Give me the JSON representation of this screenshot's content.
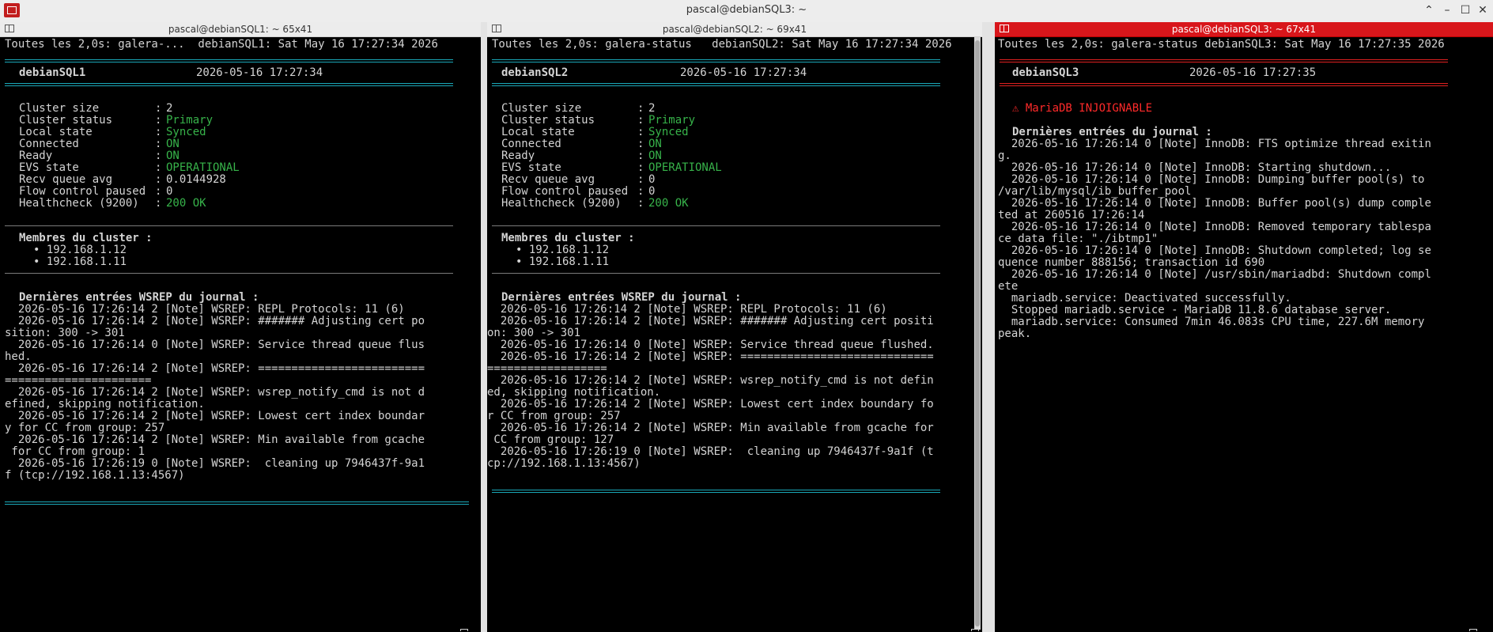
{
  "window": {
    "title": "pascal@debianSQL3: ~",
    "ctl_up": "⌃",
    "ctl_min": "–",
    "ctl_max": "☐",
    "ctl_close": "✕"
  },
  "pane1": {
    "title": "pascal@debianSQL1: ~ 65x41",
    "header": "Toutes les 2,0s: galera-...  debianSQL1: Sat May 16 17:27:34 2026",
    "host": "debianSQL1",
    "time": "2026-05-16 17:27:34",
    "stats": [
      {
        "label": "Cluster size",
        "value": "2",
        "green": false
      },
      {
        "label": "Cluster status",
        "value": "Primary",
        "green": true
      },
      {
        "label": "Local state",
        "value": "Synced",
        "green": true
      },
      {
        "label": "Connected",
        "value": "ON",
        "green": true
      },
      {
        "label": "Ready",
        "value": "ON",
        "green": true
      },
      {
        "label": "EVS state",
        "value": "OPERATIONAL",
        "green": true
      },
      {
        "label": "Recv queue avg",
        "value": "0.0144928",
        "green": false
      },
      {
        "label": "Flow control paused",
        "value": "0",
        "green": false
      },
      {
        "label": "Healthcheck (9200)",
        "value": "200 OK",
        "green": true
      }
    ],
    "members_title": "Membres du cluster :",
    "members": [
      "• 192.168.1.12",
      "• 192.168.1.11"
    ],
    "log_title": "Dernières entrées WSREP du journal :",
    "log": [
      "  2026-05-16 17:26:14 2 [Note] WSREP: REPL Protocols: 11 (6)",
      "  2026-05-16 17:26:14 2 [Note] WSREP: ####### Adjusting cert po",
      "sition: 300 -> 301",
      "  2026-05-16 17:26:14 0 [Note] WSREP: Service thread queue flus",
      "hed.",
      "  2026-05-16 17:26:14 2 [Note] WSREP: =========================",
      "======================",
      "  2026-05-16 17:26:14 2 [Note] WSREP: wsrep_notify_cmd is not d",
      "efined, skipping notification.",
      "  2026-05-16 17:26:14 2 [Note] WSREP: Lowest cert index boundar",
      "y for CC from group: 257",
      "  2026-05-16 17:26:14 2 [Note] WSREP: Min available from gcache",
      " for CC from group: 1",
      "  2026-05-16 17:26:19 0 [Note] WSREP:  cleaning up 7946437f-9a1",
      "f (tcp://192.168.1.13:4567)"
    ]
  },
  "pane2": {
    "title": "pascal@debianSQL2: ~ 69x41",
    "header": "Toutes les 2,0s: galera-status   debianSQL2: Sat May 16 17:27:34 2026",
    "host": "debianSQL2",
    "time": "2026-05-16 17:27:34",
    "stats": [
      {
        "label": "Cluster size",
        "value": "2",
        "green": false
      },
      {
        "label": "Cluster status",
        "value": "Primary",
        "green": true
      },
      {
        "label": "Local state",
        "value": "Synced",
        "green": true
      },
      {
        "label": "Connected",
        "value": "ON",
        "green": true
      },
      {
        "label": "Ready",
        "value": "ON",
        "green": true
      },
      {
        "label": "EVS state",
        "value": "OPERATIONAL",
        "green": true
      },
      {
        "label": "Recv queue avg",
        "value": "0",
        "green": false
      },
      {
        "label": "Flow control paused",
        "value": "0",
        "green": false
      },
      {
        "label": "Healthcheck (9200)",
        "value": "200 OK",
        "green": true
      }
    ],
    "members_title": "Membres du cluster :",
    "members": [
      "• 192.168.1.12",
      "• 192.168.1.11"
    ],
    "log_title": "Dernières entrées WSREP du journal :",
    "log": [
      "  2026-05-16 17:26:14 2 [Note] WSREP: REPL Protocols: 11 (6)",
      "  2026-05-16 17:26:14 2 [Note] WSREP: ####### Adjusting cert positi",
      "on: 300 -> 301",
      "  2026-05-16 17:26:14 0 [Note] WSREP: Service thread queue flushed.",
      "  2026-05-16 17:26:14 2 [Note] WSREP: =============================",
      "==================",
      "  2026-05-16 17:26:14 2 [Note] WSREP: wsrep_notify_cmd is not defin",
      "ed, skipping notification.",
      "  2026-05-16 17:26:14 2 [Note] WSREP: Lowest cert index boundary fo",
      "r CC from group: 257",
      "  2026-05-16 17:26:14 2 [Note] WSREP: Min available from gcache for",
      " CC from group: 127",
      "  2026-05-16 17:26:19 0 [Note] WSREP:  cleaning up 7946437f-9a1f (t",
      "cp://192.168.1.13:4567)"
    ]
  },
  "pane3": {
    "title": "pascal@debianSQL3: ~ 67x41",
    "header": "Toutes les 2,0s: galera-status debianSQL3: Sat May 16 17:27:35 2026",
    "host": "debianSQL3",
    "time": "2026-05-16 17:27:35",
    "alert": "⚠ MariaDB INJOIGNABLE",
    "log_title": "Dernières entrées du journal :",
    "log": [
      "  2026-05-16 17:26:14 0 [Note] InnoDB: FTS optimize thread exitin",
      "g.",
      "  2026-05-16 17:26:14 0 [Note] InnoDB: Starting shutdown...",
      "  2026-05-16 17:26:14 0 [Note] InnoDB: Dumping buffer pool(s) to",
      "/var/lib/mysql/ib_buffer_pool",
      "  2026-05-16 17:26:14 0 [Note] InnoDB: Buffer pool(s) dump comple",
      "ted at 260516 17:26:14",
      "  2026-05-16 17:26:14 0 [Note] InnoDB: Removed temporary tablespa",
      "ce data file: \"./ibtmp1\"",
      "  2026-05-16 17:26:14 0 [Note] InnoDB: Shutdown completed; log se",
      "quence number 888156; transaction id 690",
      "  2026-05-16 17:26:14 0 [Note] /usr/sbin/mariadbd: Shutdown compl",
      "ete",
      "  mariadb.service: Deactivated successfully.",
      "  Stopped mariadb.service - MariaDB 11.8.6 database server.",
      "  mariadb.service: Consumed 7min 46.083s CPU time, 227.6M memory",
      "peak."
    ]
  }
}
